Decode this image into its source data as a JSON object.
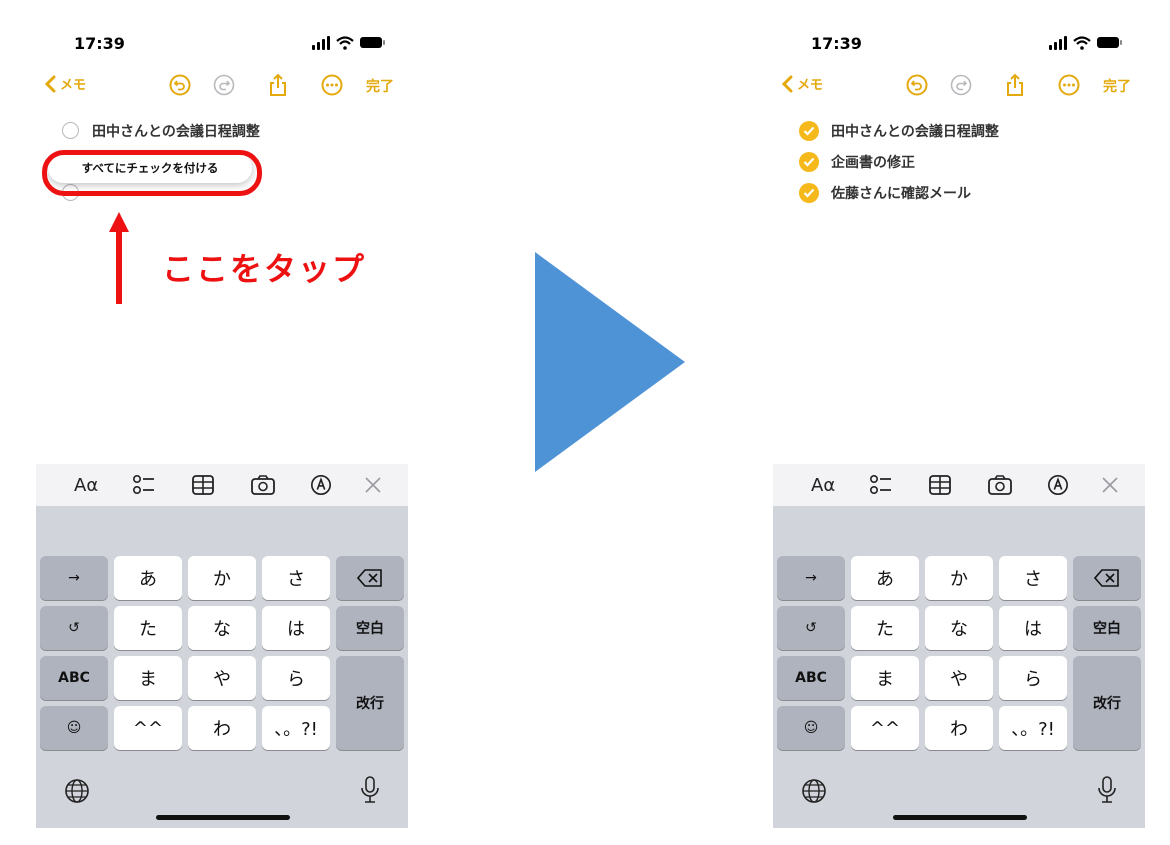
{
  "left_screen": {
    "time": "17:39",
    "back_label": "メモ",
    "done_label": "完了",
    "items": [
      {
        "text": "田中さんとの会議日程調整",
        "checked": false
      },
      {
        "text": "",
        "checked": false
      },
      {
        "text": "",
        "checked": false
      }
    ],
    "popup_label": "すべてにチェックを付ける",
    "annotation": "ここをタップ"
  },
  "right_screen": {
    "time": "17:39",
    "back_label": "メモ",
    "done_label": "完了",
    "items": [
      {
        "text": "田中さんとの会議日程調整",
        "checked": true
      },
      {
        "text": "企画書の修正",
        "checked": true
      },
      {
        "text": "佐藤さんに確認メール",
        "checked": true
      }
    ]
  },
  "toolbar": {
    "format_label": "Aα",
    "icons": [
      "checklist-icon",
      "table-icon",
      "camera-icon",
      "markup-icon",
      "close-icon"
    ]
  },
  "keyboard": {
    "row1": [
      "→",
      "あ",
      "か",
      "さ",
      "⌫"
    ],
    "row2": [
      "↺",
      "た",
      "な",
      "は",
      "空白"
    ],
    "row3": [
      "ABC",
      "ま",
      "や",
      "ら",
      "改行"
    ],
    "row4": [
      "☺",
      "^^",
      "わ",
      "、。?!"
    ]
  },
  "colors": {
    "accent": "#e3a90d",
    "check_fill": "#f6b91c",
    "annotation_red": "#ee1111",
    "arrow_blue": "#4f93d7",
    "keyboard_bg": "#d1d4da"
  }
}
